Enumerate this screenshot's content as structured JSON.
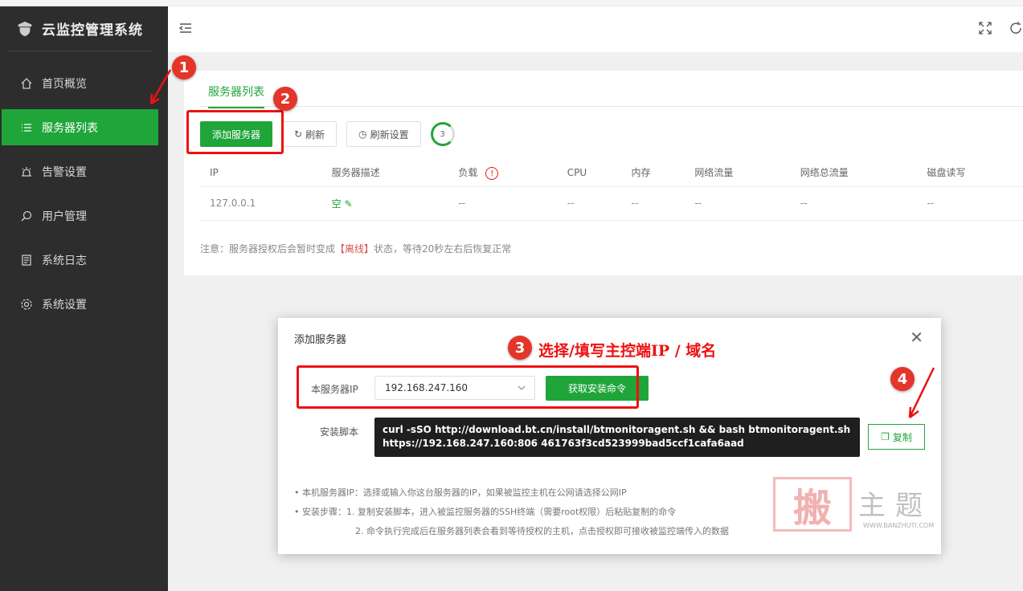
{
  "sidebar": {
    "title": "云监控管理系统",
    "items": [
      {
        "label": "首页概览",
        "icon": "home-icon"
      },
      {
        "label": "服务器列表",
        "icon": "list-icon"
      },
      {
        "label": "告警设置",
        "icon": "alarm-icon"
      },
      {
        "label": "用户管理",
        "icon": "search-icon"
      },
      {
        "label": "系统日志",
        "icon": "log-icon"
      },
      {
        "label": "系统设置",
        "icon": "gear-icon"
      }
    ]
  },
  "main": {
    "tab": "服务器列表",
    "buttons": {
      "add": "添加服务器",
      "refresh": "刷新",
      "refresh_settings": "刷新设置",
      "countdown": "3"
    },
    "table": {
      "headers": [
        "IP",
        "服务器描述",
        "负载",
        "CPU",
        "内存",
        "网络流量",
        "网络总流量",
        "磁盘读写"
      ],
      "rows": [
        [
          "127.0.0.1",
          "空",
          "--",
          "--",
          "--",
          "--",
          "--",
          "--"
        ]
      ]
    },
    "note_prefix": "注意：服务器授权后会暂时变成",
    "note_red": "【离线】",
    "note_suffix": "状态，等待20秒左右后恢复正常"
  },
  "dialog": {
    "title": "添加服务器",
    "ip_label": "本服务器IP",
    "ip_value": "192.168.247.160",
    "get_cmd": "获取安装命令",
    "script_label": "安装脚本",
    "script_line1": "curl -sSO http://download.bt.cn/install/btmonitoragent.sh && bash btmonitoragent.sh",
    "script_line2": "https://192.168.247.160:806 461763f3cd523999bad5ccf1cafa6aad",
    "copy": "复制",
    "tip1": "•  本机服务器IP：选择或输入你这台服务器的IP，如果被监控主机在公网请选择公网IP",
    "tip2": "•  安装步骤：1. 复制安装脚本，进入被监控服务器的SSH终端（需要root权限）后粘贴复制的命令",
    "tip3": "2. 命令执行完成后在服务器列表会看到等待授权的主机，点击授权即可接收被监控端传入的数据"
  },
  "annotations": {
    "m1": "1",
    "m2": "2",
    "m3": "3",
    "m4": "4",
    "text3": "选择/填写主控端IP / 域名"
  },
  "watermark": {
    "char": "搬",
    "text": "主题",
    "url": "WWW.BANZHUTI.COM"
  },
  "colors": {
    "accent": "#20a53a",
    "sidebar": "#2d2d2d",
    "annotation": "#e11111"
  }
}
